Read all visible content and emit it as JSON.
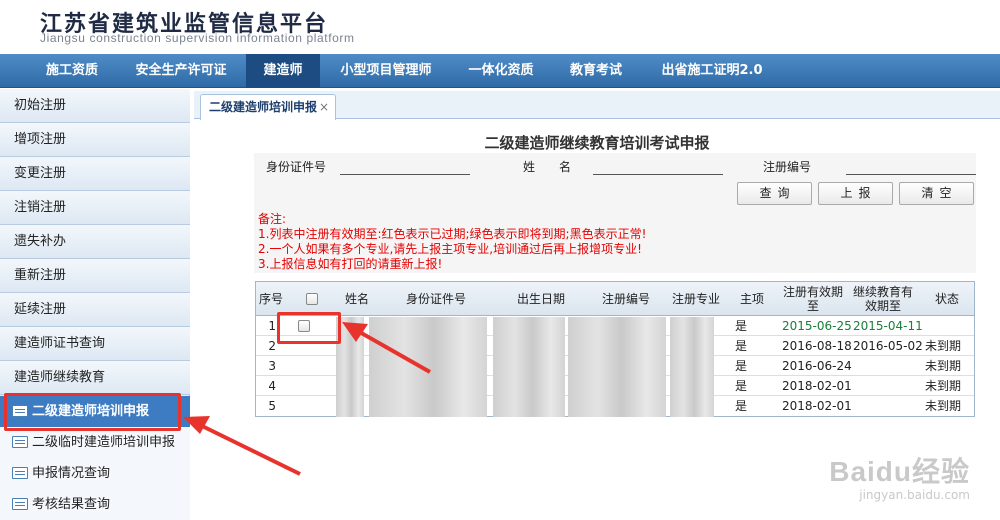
{
  "header": {
    "title_cn": "江苏省建筑业监管信息平台",
    "title_en": "Jiangsu construction supervision information platform"
  },
  "nav": {
    "items": [
      {
        "label": "施工资质"
      },
      {
        "label": "安全生产许可证"
      },
      {
        "label": "建造师",
        "active": true
      },
      {
        "label": "小型项目管理师"
      },
      {
        "label": "一体化资质"
      },
      {
        "label": "教育考试"
      },
      {
        "label": "出省施工证明2.0"
      }
    ]
  },
  "sidebar": {
    "items": [
      {
        "label": "初始注册"
      },
      {
        "label": "增项注册"
      },
      {
        "label": "变更注册"
      },
      {
        "label": "注销注册"
      },
      {
        "label": "遗失补办"
      },
      {
        "label": "重新注册"
      },
      {
        "label": "延续注册"
      },
      {
        "label": "建造师证书查询"
      },
      {
        "label": "建造师继续教育"
      }
    ],
    "sub_items": [
      {
        "label": "二级建造师培训申报",
        "active": true
      },
      {
        "label": "二级临时建造师培训申报"
      },
      {
        "label": "申报情况查询"
      },
      {
        "label": "考核结果查询"
      }
    ]
  },
  "tabs": [
    {
      "label": "二级建造师培训申报",
      "close": "×"
    }
  ],
  "form": {
    "title": "二级建造师继续教育培训考试申报",
    "id_label": "身份证件号",
    "name_label": "姓　　名",
    "reg_label": "注册编号",
    "id_value": "",
    "name_value": "",
    "reg_value": "",
    "buttons": {
      "query": "查询",
      "submit": "上报",
      "clear": "清空"
    }
  },
  "notes": [
    "备注:",
    "1.列表中注册有效期至:红色表示已过期;绿色表示即将到期;黑色表示正常!",
    "2.一个人如果有多个专业,请先上报主项专业,培训通过后再上报增项专业!",
    "3.上报信息如有打回的请重新上报!"
  ],
  "table": {
    "headers": {
      "seq": "序号",
      "name": "姓名",
      "id": "身份证件号",
      "birth": "出生日期",
      "reg": "注册编号",
      "major": "注册专业",
      "main": "主项",
      "valid1": "注册有效期",
      "valid2": "至",
      "edu1": "继续教育有",
      "edu2": "效期至",
      "status": "状态"
    },
    "rows": [
      {
        "seq": "1",
        "main": "是",
        "valid": "2015-06-25",
        "edu": "2015-04-11",
        "status": "",
        "green": true
      },
      {
        "seq": "2",
        "main": "是",
        "valid": "2016-08-18",
        "edu": "2016-05-02",
        "status": "未到期",
        "green": false
      },
      {
        "seq": "3",
        "main": "是",
        "valid": "2016-06-24",
        "edu": "",
        "status": "未到期",
        "green": false
      },
      {
        "seq": "4",
        "main": "是",
        "valid": "2018-02-01",
        "edu": "",
        "status": "未到期",
        "green": false
      },
      {
        "seq": "5",
        "main": "是",
        "valid": "2018-02-01",
        "edu": "",
        "status": "未到期",
        "green": false
      }
    ]
  },
  "watermark": {
    "main": "Baidu经验",
    "sub": "jingyan.baidu.com"
  },
  "colors": {
    "nav_blue": "#2f6aa7",
    "active_blue": "#3d7cc2",
    "note_red": "#e60000",
    "near_expiry_green": "#17803a",
    "highlight_red": "#e8332d"
  }
}
